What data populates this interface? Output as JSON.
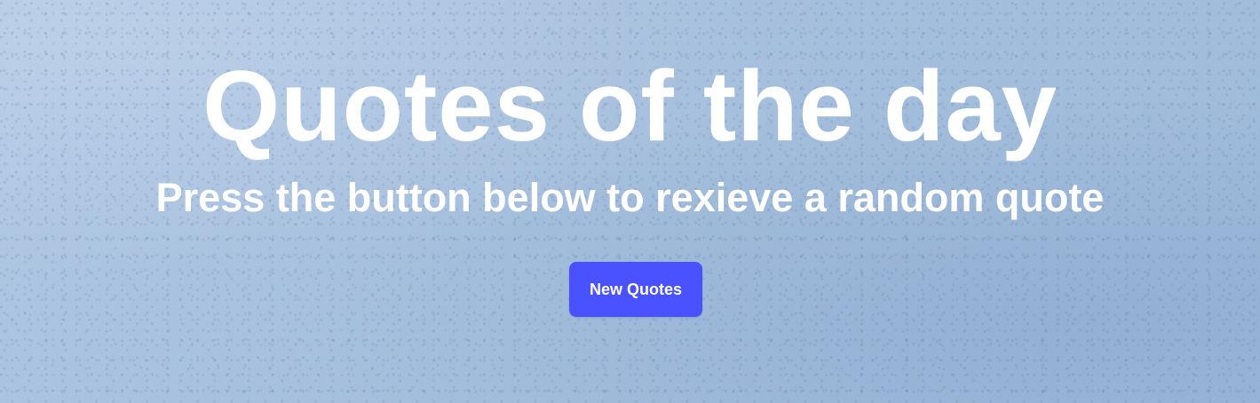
{
  "hero": {
    "title": "Quotes of the day",
    "subtitle": "Press the button below to rexieve a random quote",
    "button_label": "New Quotes"
  },
  "colors": {
    "background": "#a9c3e2",
    "text": "#ffffff",
    "button": "#4a52ff",
    "button_text": "#ffffff"
  }
}
